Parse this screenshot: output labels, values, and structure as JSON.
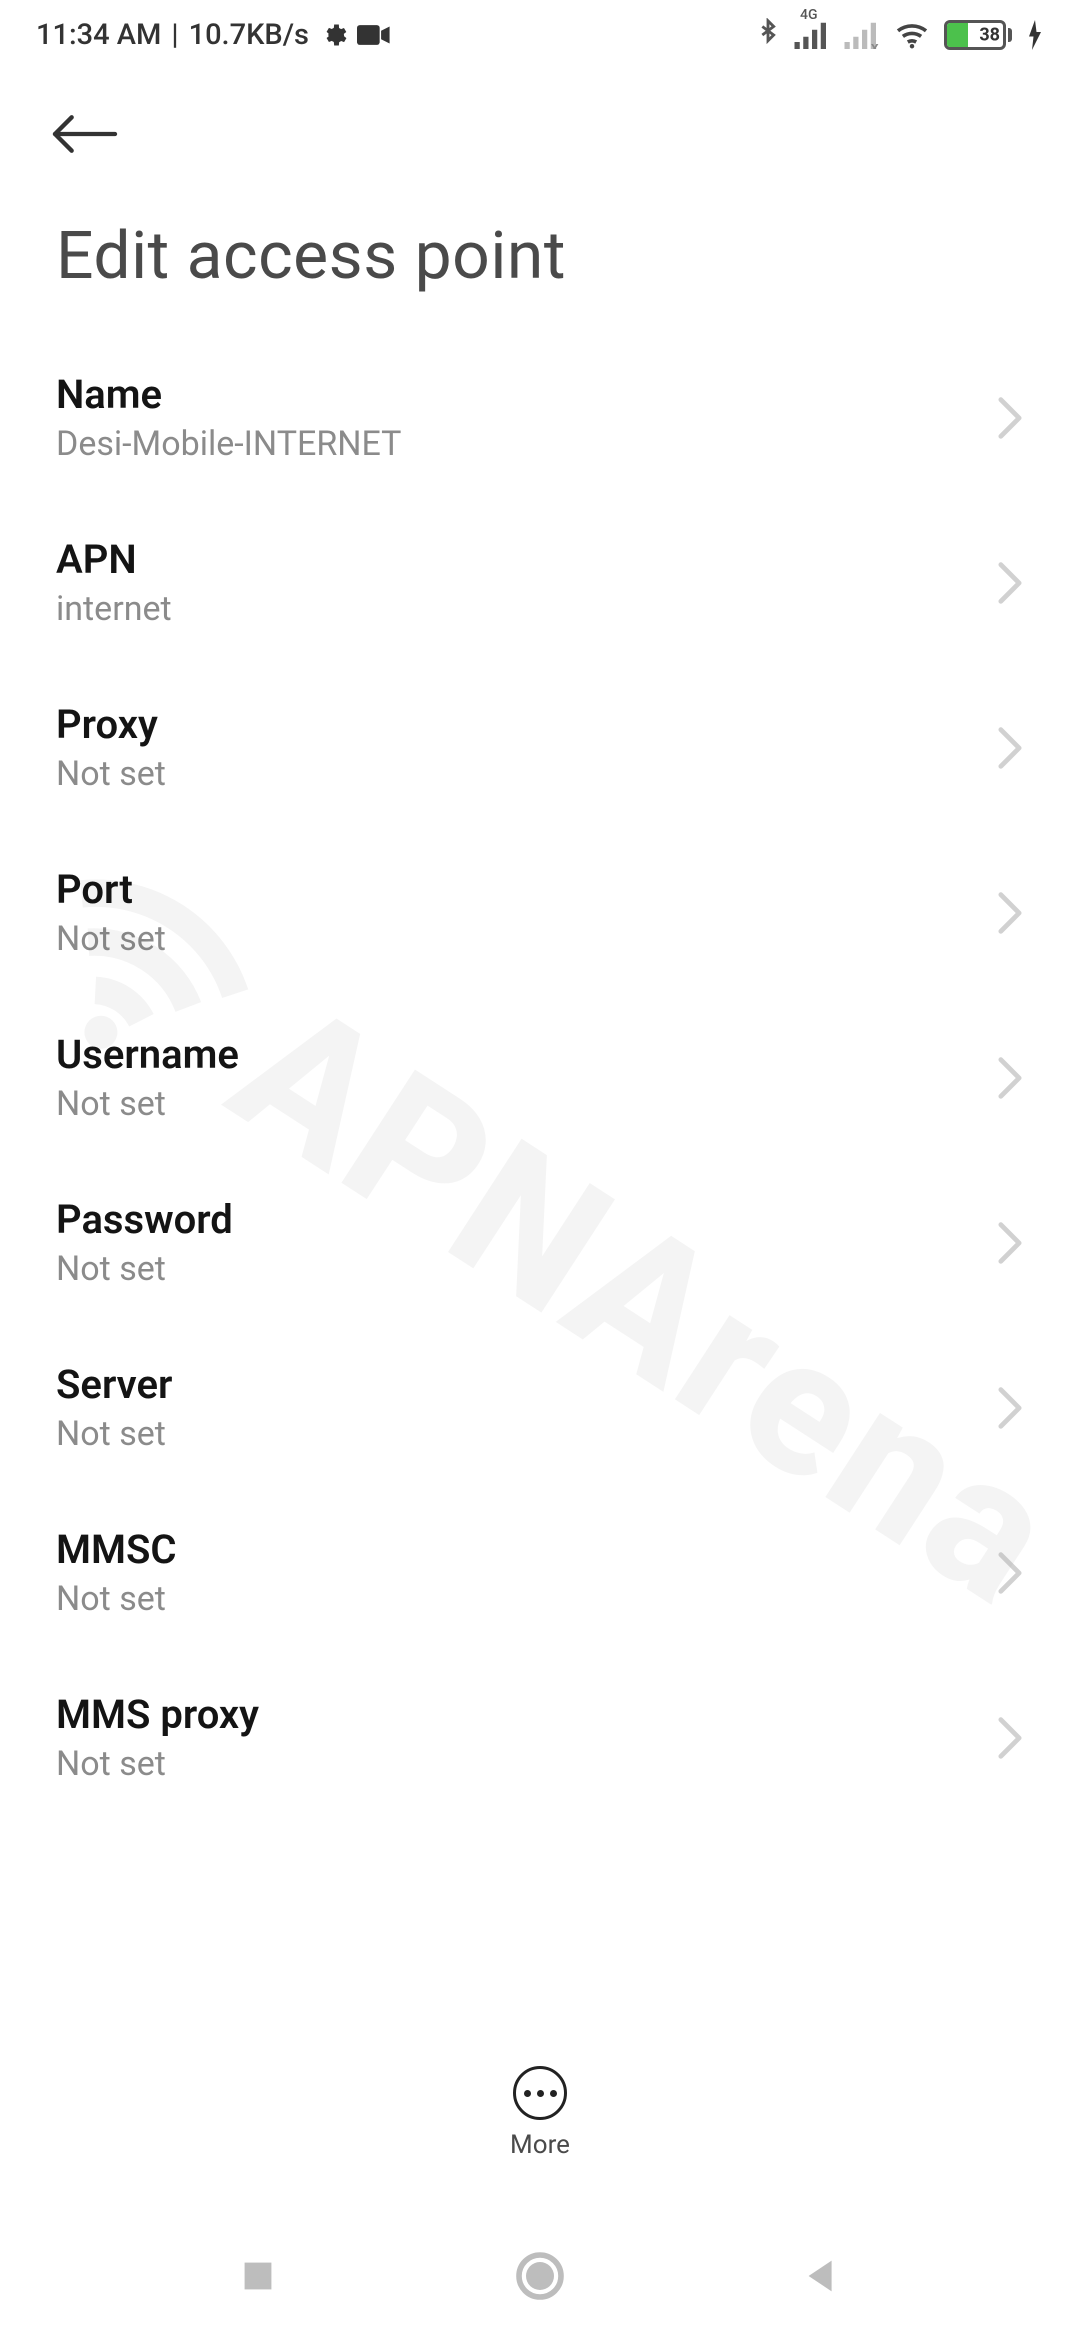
{
  "status": {
    "time": "11:34 AM",
    "separator": "|",
    "speed": "10.7KB/s",
    "battery_percent": "38",
    "network_label": "4G"
  },
  "header": {
    "title": "Edit access point"
  },
  "rows": [
    {
      "label": "Name",
      "value": "Desi-Mobile-INTERNET",
      "key": "name"
    },
    {
      "label": "APN",
      "value": "internet",
      "key": "apn"
    },
    {
      "label": "Proxy",
      "value": "Not set",
      "key": "proxy"
    },
    {
      "label": "Port",
      "value": "Not set",
      "key": "port"
    },
    {
      "label": "Username",
      "value": "Not set",
      "key": "username"
    },
    {
      "label": "Password",
      "value": "Not set",
      "key": "password"
    },
    {
      "label": "Server",
      "value": "Not set",
      "key": "server"
    },
    {
      "label": "MMSC",
      "value": "Not set",
      "key": "mmsc"
    },
    {
      "label": "MMS proxy",
      "value": "Not set",
      "key": "mms-proxy"
    }
  ],
  "more_label": "More",
  "watermark": "APNArena"
}
